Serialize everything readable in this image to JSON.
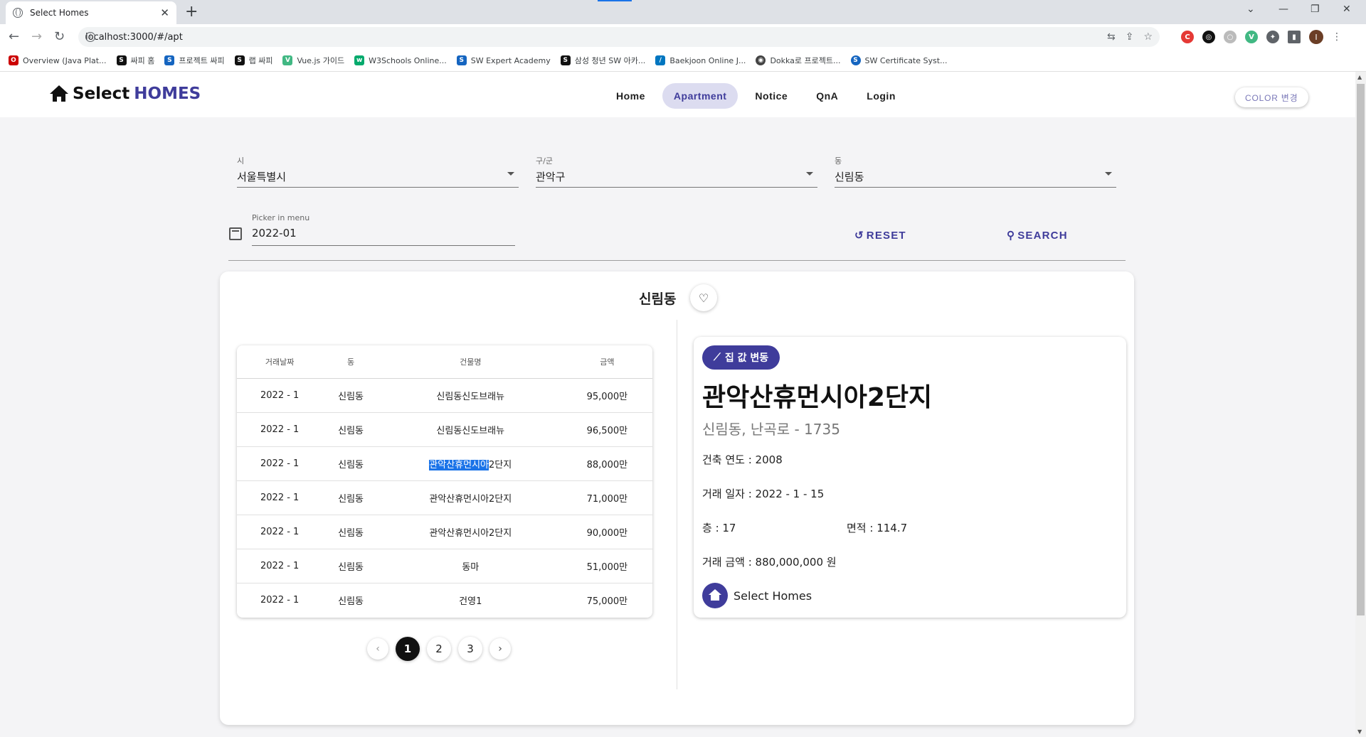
{
  "browser": {
    "tab_title": "Select Homes",
    "tab_close": "✕",
    "new_tab": "+",
    "url": "localhost:3000/#/apt",
    "window_controls": [
      "⌄",
      "—",
      "❐",
      "✕"
    ],
    "bookmarks": [
      {
        "label": "Overview (Java Plat...",
        "color": "#c00"
      },
      {
        "label": "싸피 홈",
        "color": "#111"
      },
      {
        "label": "프로젝트 싸피",
        "color": "#1565c0"
      },
      {
        "label": "랩 싸피",
        "color": "#111"
      },
      {
        "label": "Vue.js 가이드",
        "color": "#41b883"
      },
      {
        "label": "W3Schools Online...",
        "color": "#04aa6d"
      },
      {
        "label": "SW Expert Academy",
        "color": "#1565c0"
      },
      {
        "label": "삼성 청년 SW 아카...",
        "color": "#111"
      },
      {
        "label": "Baekjoon Online J...",
        "color": "#0076c0"
      },
      {
        "label": "Dokka로 프로젝트...",
        "color": "#444"
      },
      {
        "label": "SW Certificate Syst...",
        "color": "#1565c0"
      }
    ]
  },
  "header": {
    "brand_prefix": "Select ",
    "brand_accent": "HOMES",
    "nav": [
      "Home",
      "Apartment",
      "Notice",
      "QnA",
      "Login"
    ],
    "active_nav": "Apartment",
    "color_button": "COLOR 변경"
  },
  "filters": {
    "city": {
      "label": "시",
      "value": "서울특별시"
    },
    "gugun": {
      "label": "구/군",
      "value": "관악구"
    },
    "dong": {
      "label": "동",
      "value": "신림동"
    },
    "date": {
      "label": "Picker in menu",
      "value": "2022-01"
    },
    "reset_label": "RESET",
    "search_label": "SEARCH"
  },
  "result": {
    "dong_title": "신림동",
    "table": {
      "headers": [
        "거래날짜",
        "동",
        "건물명",
        "금액"
      ],
      "rows": [
        [
          "2022 - 1",
          "신림동",
          "신림동신도브래뉴",
          "95,000만"
        ],
        [
          "2022 - 1",
          "신림동",
          "신림동신도브래뉴",
          "96,500만"
        ],
        [
          "2022 - 1",
          "신림동",
          "관악산휴먼시아2단지",
          "88,000만"
        ],
        [
          "2022 - 1",
          "신림동",
          "관악산휴먼시아2단지",
          "71,000만"
        ],
        [
          "2022 - 1",
          "신림동",
          "관악산휴먼시아2단지",
          "90,000만"
        ],
        [
          "2022 - 1",
          "신림동",
          "동마",
          "51,000만"
        ],
        [
          "2022 - 1",
          "신림동",
          "건영1",
          "75,000만"
        ]
      ],
      "highlight": {
        "selected": "관악산휴먼시아",
        "rest": "2단지"
      }
    },
    "pagination": {
      "pages": [
        "1",
        "2",
        "3"
      ],
      "current": "1",
      "prev": "‹",
      "next": "›"
    }
  },
  "detail": {
    "chip_label": "집 값 변동",
    "apt_name": "관악산휴먼시아2단지",
    "address": "신림동, 난곡로 - 1735",
    "build_year": "건축 연도 : 2008",
    "deal_date": "거래 일자 : 2022 - 1 - 15",
    "floor": "층 : 17",
    "area": "면적 : 114.7",
    "price": "거래 금액 : 880,000,000 원",
    "footer_name": "Select Homes"
  },
  "colors": {
    "accent": "#3f3c9b",
    "active_nav_bg": "#dcdcf0",
    "selection": "#1a73e8"
  }
}
